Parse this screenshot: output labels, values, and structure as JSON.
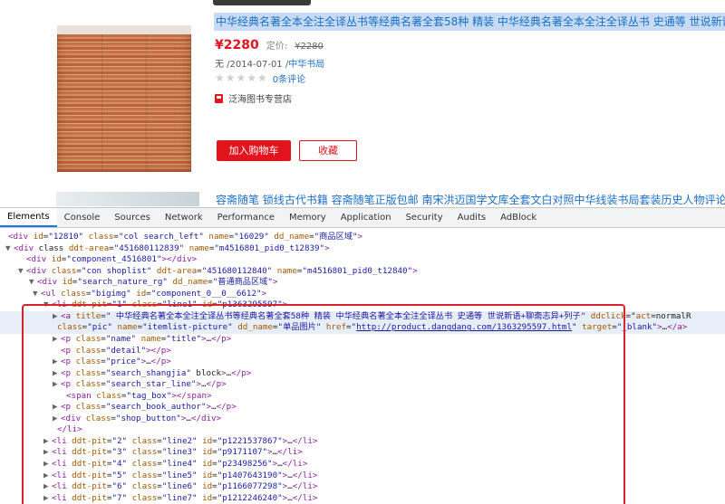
{
  "product": {
    "title": "中华经典名著全本全注全译丛书等经典名著全套58种 精装 中华经典名著全本全注全译丛书 史通等 世说新语+聊斋",
    "price": "¥2280",
    "list_price_label": "定价:",
    "list_price": "¥2280",
    "pub_date": "无 /2014-07-01 /",
    "publisher": "中华书局",
    "stars": "★★★★★",
    "reviews": "0条评论",
    "shop": "泛海图书专营店",
    "add_to_cart": "加入购物车",
    "favorite": "收藏",
    "next_title": "容斋随笔 锁线古代书籍 容斋随笔正版包邮 南宋洪迈国学文库全套文白对照中华线装书局套装历史人物评论史料"
  },
  "devtools": {
    "tabs": [
      "Elements",
      "Console",
      "Sources",
      "Network",
      "Performance",
      "Memory",
      "Application",
      "Security",
      "Audits",
      "AdBlock"
    ],
    "lines": [
      [
        "",
        "<div id=\"12810\" class=\"col search_left\" name=\"16029\" dd_name=\"商品区域\">"
      ],
      [
        "▼",
        "<div class ddt-area=\"451680112839\" name=\"m4516801_pid0_t12839\">"
      ],
      [
        "",
        "<div id=\"component_4516801\"></div>"
      ],
      [
        "▼",
        "<div class=\"con shoplist\" ddt-area=\"451680112840\" name=\"m4516801_pid0_t12840\">"
      ],
      [
        "▼",
        "<div id=\"search_nature_rg\" dd_name=\"普通商品区域\">"
      ],
      [
        "▼",
        "<ul class=\"bigimg\" id=\"component_0__0__6612\">"
      ],
      [
        "▼",
        "<li ddt-pit=\"1\" class=\"line1\" id=\"p1363295597\">"
      ],
      [
        "▶",
        "<a title=\" 中华经典名著全本全注全译丛书等经典名著全套58种 精装 中华经典名著全本全注全译丛书 史通等 世说新语+聊斋志异+列子\" ddclick=\"act=normalR"
      ],
      [
        "",
        "class=\"pic\" name=\"itemlist-picture\" dd_name=\"单品图片\" href=\"http://product.dangdang.com/1363295597.html\" target=\"_blank\">…</a>"
      ],
      [
        "▶",
        "<p class=\"name\" name=\"title\">…</p>"
      ],
      [
        "",
        "<p class=\"detail\"></p>"
      ],
      [
        "▶",
        "<p class=\"price\">…</p>"
      ],
      [
        "▶",
        "<p class=\"search_shangjia\" block>…</p>"
      ],
      [
        "▶",
        "<p class=\"search_star_line\">…</p>"
      ],
      [
        "",
        "<span class=\"tag_box\"></span>"
      ],
      [
        "▶",
        "<p class=\"search_book_author\">…</p>"
      ],
      [
        "▶",
        "<div class=\"shop_button\">…</div>"
      ],
      [
        "",
        "</li>"
      ],
      [
        "▶",
        "<li ddt-pit=\"2\" class=\"line2\" id=\"p1221537867\">…</li>"
      ],
      [
        "▶",
        "<li ddt-pit=\"3\" class=\"line3\" id=\"p9171107\">…</li>"
      ],
      [
        "▶",
        "<li ddt-pit=\"4\" class=\"line4\" id=\"p23498256\">…</li>"
      ],
      [
        "▶",
        "<li ddt-pit=\"5\" class=\"line5\" id=\"p1407643190\">…</li>"
      ],
      [
        "▶",
        "<li ddt-pit=\"6\" class=\"line6\" id=\"p1166077298\">…</li>"
      ],
      [
        "▶",
        "<li ddt-pit=\"7\" class=\"line7\" id=\"p1212246240\">…</li>"
      ]
    ]
  }
}
